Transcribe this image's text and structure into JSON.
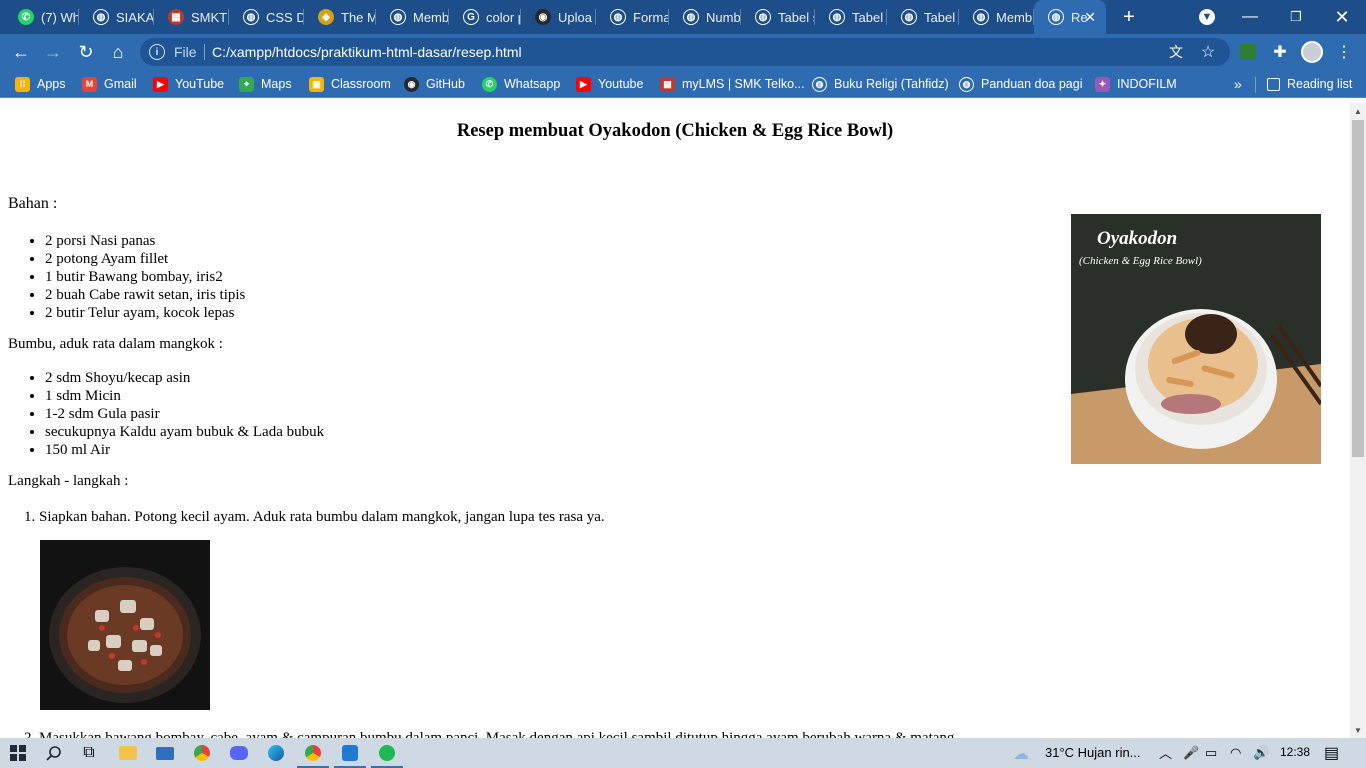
{
  "browser": {
    "tabs": [
      {
        "label": "(7) Wh",
        "icon": "whatsapp-icon",
        "color": "#25d366"
      },
      {
        "label": "SIAKA",
        "icon": "globe-icon",
        "color": "#ffffff"
      },
      {
        "label": "SMKTI",
        "icon": "school-icon",
        "color": "#c0392b"
      },
      {
        "label": "CSS D",
        "icon": "globe-icon",
        "color": "#ffffff"
      },
      {
        "label": "The M",
        "icon": "shield-icon",
        "color": "#d4a017"
      },
      {
        "label": "Memb",
        "icon": "globe-icon",
        "color": "#ffffff"
      },
      {
        "label": "color p",
        "icon": "google-icon",
        "color": "#ffffff"
      },
      {
        "label": "Uploa",
        "icon": "github-icon",
        "color": "#24292e"
      },
      {
        "label": "Forma",
        "icon": "globe-icon",
        "color": "#ffffff"
      },
      {
        "label": "Numb",
        "icon": "globe-icon",
        "color": "#ffffff"
      },
      {
        "label": "Tabel s",
        "icon": "globe-icon",
        "color": "#ffffff"
      },
      {
        "label": "Tabel I",
        "icon": "globe-icon",
        "color": "#ffffff"
      },
      {
        "label": "Tabel",
        "icon": "globe-icon",
        "color": "#ffffff"
      },
      {
        "label": "Memb",
        "icon": "globe-icon",
        "color": "#ffffff"
      },
      {
        "label": "Re",
        "icon": "globe-icon",
        "color": "#ffffff",
        "active": true
      }
    ],
    "new_tab": "+",
    "url_scheme": "File",
    "url": "C:/xampp/htdocs/praktikum-html-dasar/resep.html",
    "bookmarks": [
      {
        "label": "Apps",
        "icon": "apps-grid-icon",
        "color": "#f4b400"
      },
      {
        "label": "Gmail",
        "icon": "gmail-icon",
        "color": "#ea4335"
      },
      {
        "label": "YouTube",
        "icon": "youtube-icon",
        "color": "#ff0000"
      },
      {
        "label": "Maps",
        "icon": "maps-icon",
        "color": "#34a853"
      },
      {
        "label": "Classroom",
        "icon": "classroom-icon",
        "color": "#f4b400"
      },
      {
        "label": "GitHub",
        "icon": "github-icon",
        "color": "#24292e"
      },
      {
        "label": "Whatsapp",
        "icon": "whatsapp-icon",
        "color": "#25d366"
      },
      {
        "label": "Youtube",
        "icon": "youtube-icon",
        "color": "#ff0000"
      },
      {
        "label": "myLMS | SMK Telko...",
        "icon": "school-icon",
        "color": "#c0392b"
      },
      {
        "label": "Buku Religi (Tahfidz)",
        "icon": "globe-icon",
        "color": "#ffffff"
      },
      {
        "label": "Panduan doa pagi",
        "icon": "globe-icon",
        "color": "#ffffff"
      },
      {
        "label": "INDOFILM",
        "icon": "film-icon",
        "color": "#9b59b6"
      }
    ],
    "more_bookmarks": "»",
    "reading_list": "Reading list"
  },
  "page": {
    "title": "Resep membuat Oyakodon (Chicken & Egg Rice Bowl)",
    "bahan_heading": "Bahan :",
    "bahan": [
      "2 porsi Nasi panas",
      "2 potong Ayam fillet",
      "1 butir Bawang bombay, iris2",
      "2 buah Cabe rawit setan, iris tipis",
      "2 butir Telur ayam, kocok lepas"
    ],
    "bumbu_heading": "Bumbu, aduk rata dalam mangkok :",
    "bumbu": [
      "2 sdm Shoyu/kecap asin",
      "1 sdm Micin",
      "1-2 sdm Gula pasir",
      "secukupnya Kaldu ayam bubuk & Lada bubuk",
      "150 ml Air"
    ],
    "langkah_heading": "Langkah - langkah :",
    "langkah": [
      "Siapkan bahan. Potong kecil ayam. Aduk rata bumbu dalam mangkok, jangan lupa tes rasa ya.",
      "Masukkan bawang bombay, cabe, ayam & campuran bumbu dalam panci. Masak dengan api kecil sambil ditutup hingga ayam berubah warna & matang."
    ],
    "hero_image": {
      "title": "Oyakodon",
      "subtitle": "(Chicken & Egg Rice Bowl)"
    }
  },
  "taskbar": {
    "weather": "31°C  Hujan rin...",
    "time": "12:38"
  }
}
